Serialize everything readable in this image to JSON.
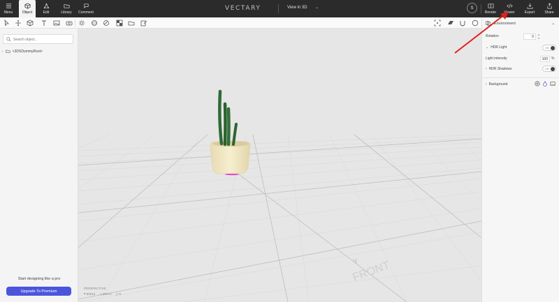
{
  "topbar": {
    "menu_label": "Menu",
    "object_label": "Object",
    "edit_label": "Edit",
    "library_label": "Library",
    "comment_label": "Comment",
    "logo_text": "VECTARY",
    "view_mode": "View in 3D",
    "avatar_initial": "S",
    "render_label": "Render",
    "viewer_label": "Viewer",
    "export_label": "Export",
    "share_label": "Share"
  },
  "left_panel": {
    "search_placeholder": "Search object...",
    "tree": [
      {
        "label": "<3DSDummyRoot>"
      }
    ],
    "promo_text": "Start designing like a pro",
    "upgrade_label": "Upgrade To Premium"
  },
  "viewport": {
    "camera_label": "PERSPECTIVE",
    "vertices": "90616",
    "faces": "30272",
    "objects": "5",
    "axis_y_label": "Y",
    "front_label": "FRONT"
  },
  "right_panel": {
    "section_title": "Environment",
    "rotation_label": "Rotation",
    "rotation_value": "0",
    "hdr_light_label": "HDR Light",
    "hdr_light_toggle": "ON",
    "light_intensity_label": "Light intensity",
    "light_intensity_value": "100",
    "light_intensity_unit": "%",
    "hdr_shadows_label": "HDR Shadows",
    "hdr_shadows_toggle": "ON",
    "background_label": "Background"
  },
  "colors": {
    "topbar_bg": "#2b2b2b",
    "accent": "#4b55dc",
    "annotation_arrow": "#e0201b",
    "pot": "#f0e6c4",
    "cactus": "#2f6b34"
  }
}
